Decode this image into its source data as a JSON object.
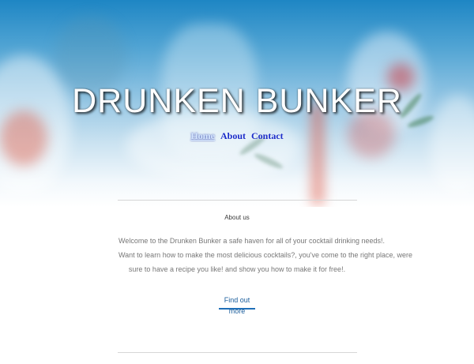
{
  "header": {
    "title": "DRUNKEN BUNKER",
    "nav": [
      {
        "label": "Home",
        "active": true
      },
      {
        "label": "About",
        "active": false
      },
      {
        "label": "Contact",
        "active": false
      }
    ]
  },
  "about": {
    "heading": "About us",
    "lines": [
      "Welcome to the Drunken Bunker a safe haven for all of your cocktail drinking needs!.",
      "Want to learn how to make the most delicious cocktails?, you've come to the right place, were",
      "sure to have a recipe you like! and show you how to make it for free!."
    ],
    "button_label": "Find out more"
  },
  "colors": {
    "accent": "#1f6fb8",
    "hero_top": "#1e86c4",
    "nav_link": "#1a2cc9"
  }
}
